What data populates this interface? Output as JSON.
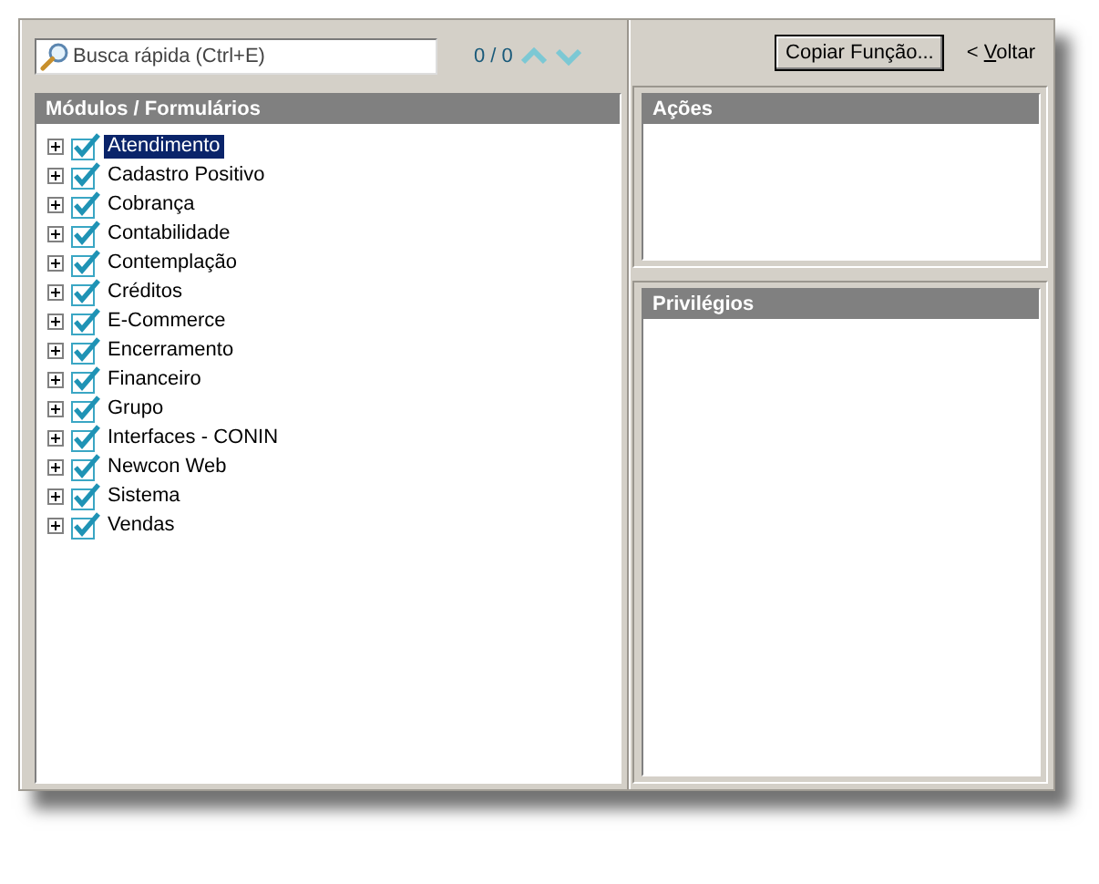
{
  "search": {
    "placeholder": "Busca rápida (Ctrl+E)",
    "count": "0 / 0"
  },
  "tree": {
    "title": "Módulos / Formulários",
    "items": [
      {
        "label": "Atendimento",
        "checked": true,
        "expanded": false,
        "selected": true
      },
      {
        "label": "Cadastro Positivo",
        "checked": true,
        "expanded": false,
        "selected": false
      },
      {
        "label": "Cobrança",
        "checked": true,
        "expanded": false,
        "selected": false
      },
      {
        "label": "Contabilidade",
        "checked": true,
        "expanded": false,
        "selected": false
      },
      {
        "label": "Contemplação",
        "checked": true,
        "expanded": false,
        "selected": false
      },
      {
        "label": "Créditos",
        "checked": true,
        "expanded": false,
        "selected": false
      },
      {
        "label": "E-Commerce",
        "checked": true,
        "expanded": false,
        "selected": false
      },
      {
        "label": "Encerramento",
        "checked": true,
        "expanded": false,
        "selected": false
      },
      {
        "label": "Financeiro",
        "checked": true,
        "expanded": false,
        "selected": false
      },
      {
        "label": "Grupo",
        "checked": true,
        "expanded": false,
        "selected": false
      },
      {
        "label": "Interfaces - CONIN",
        "checked": true,
        "expanded": false,
        "selected": false
      },
      {
        "label": "Newcon Web",
        "checked": true,
        "expanded": false,
        "selected": false
      },
      {
        "label": "Sistema",
        "checked": true,
        "expanded": false,
        "selected": false
      },
      {
        "label": "Vendas",
        "checked": true,
        "expanded": false,
        "selected": false
      }
    ]
  },
  "copy_button": "Copiar Função...",
  "back_link": {
    "arrow": "<",
    "label": "Voltar"
  },
  "actions_panel": {
    "title": "Ações"
  },
  "privileges_panel": {
    "title": "Privilégios"
  }
}
